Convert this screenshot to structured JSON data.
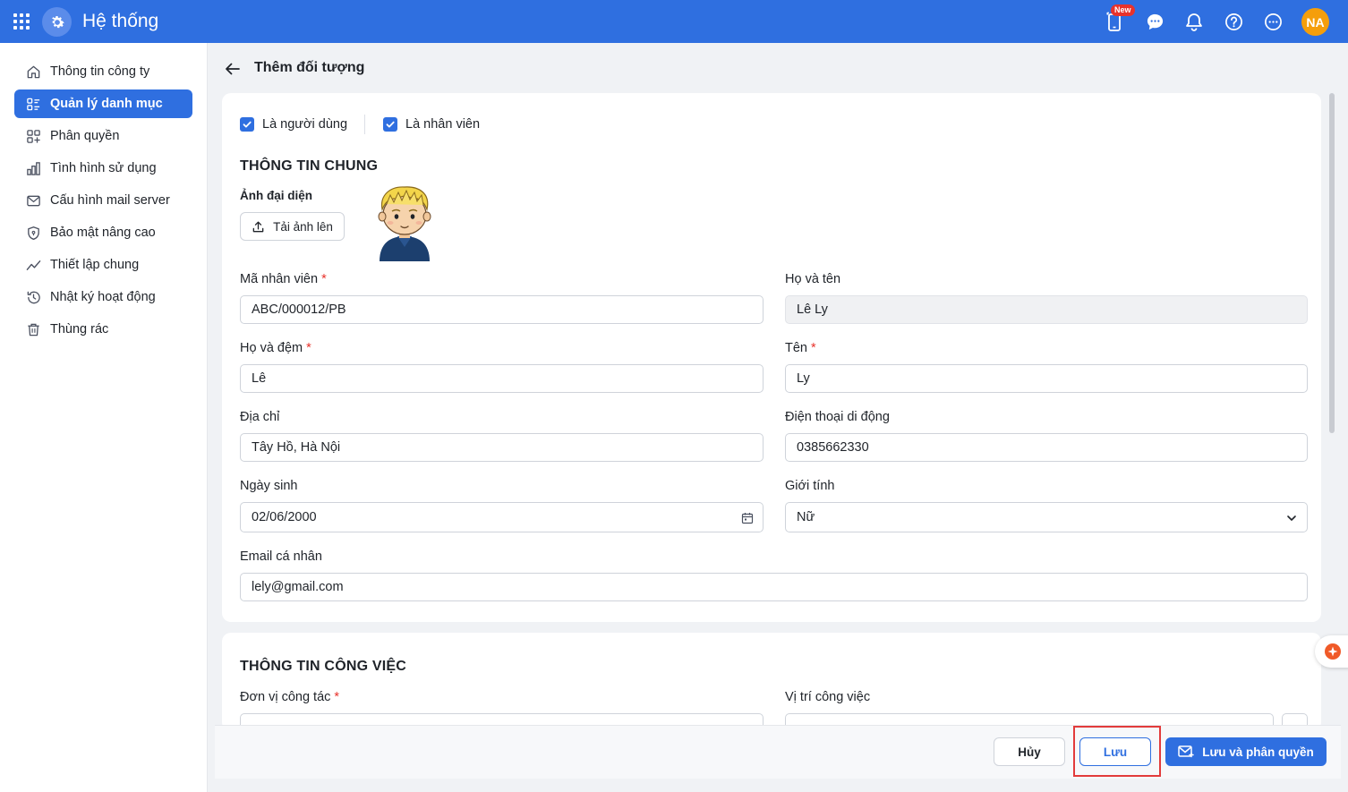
{
  "header": {
    "app_title": "Hệ thống",
    "new_badge": "New",
    "user_initials": "NA",
    "icons": [
      "apps-grid-icon",
      "gear-icon",
      "mobile-app-icon",
      "chat-icon",
      "bell-icon",
      "help-icon",
      "more-icon"
    ]
  },
  "sidebar": {
    "items": [
      {
        "label": "Thông tin công ty",
        "icon": "home-icon",
        "active": false
      },
      {
        "label": "Quản lý danh mục",
        "icon": "category-icon",
        "active": true
      },
      {
        "label": "Phân quyền",
        "icon": "permission-icon",
        "active": false
      },
      {
        "label": "Tình hình sử dụng",
        "icon": "chart-icon",
        "active": false
      },
      {
        "label": "Cấu hình mail server",
        "icon": "mail-icon",
        "active": false
      },
      {
        "label": "Bảo mật nâng cao",
        "icon": "shield-icon",
        "active": false
      },
      {
        "label": "Thiết lập chung",
        "icon": "trend-icon",
        "active": false
      },
      {
        "label": "Nhật ký hoạt động",
        "icon": "history-icon",
        "active": false
      },
      {
        "label": "Thùng rác",
        "icon": "trash-icon",
        "active": false
      }
    ]
  },
  "page": {
    "title": "Thêm đối tượng"
  },
  "checkboxes": {
    "is_user": {
      "label": "Là người dùng",
      "checked": true
    },
    "is_employee": {
      "label": "Là nhân viên",
      "checked": true
    }
  },
  "general": {
    "section_title": "THÔNG TIN CHUNG",
    "avatar_label": "Ảnh đại diện",
    "upload_label": "Tải ảnh lên",
    "fields": {
      "employee_code": {
        "label": "Mã nhân viên",
        "value": "ABC/000012/PB",
        "required": true
      },
      "full_name": {
        "label": "Họ và tên",
        "value": "Lê Ly",
        "required": false
      },
      "last_middle_name": {
        "label": "Họ và đệm",
        "value": "Lê",
        "required": true
      },
      "first_name": {
        "label": "Tên",
        "value": "Ly",
        "required": true
      },
      "address": {
        "label": "Địa chỉ",
        "value": "Tây Hồ, Hà Nội",
        "required": false
      },
      "mobile": {
        "label": "Điện thoại di động",
        "value": "0385662330",
        "required": false
      },
      "birthday": {
        "label": "Ngày sinh",
        "value": "02/06/2000",
        "required": false
      },
      "gender": {
        "label": "Giới tính",
        "value": "Nữ",
        "required": false
      },
      "email": {
        "label": "Email cá nhân",
        "value": "lely@gmail.com",
        "required": false
      }
    }
  },
  "work": {
    "section_title": "THÔNG TIN CÔNG VIỆC",
    "fields": {
      "department": {
        "label": "Đơn vị công tác",
        "required": true
      },
      "position": {
        "label": "Vị trí công việc",
        "required": false
      }
    }
  },
  "required_mark": "*",
  "footer": {
    "cancel_label": "Hủy",
    "save_label": "Lưu",
    "save_perm_label": "Lưu và phân quyền"
  },
  "colors": {
    "primary": "#2f6fe0",
    "required": "#e8322b",
    "highlight": "#e23b3b"
  }
}
